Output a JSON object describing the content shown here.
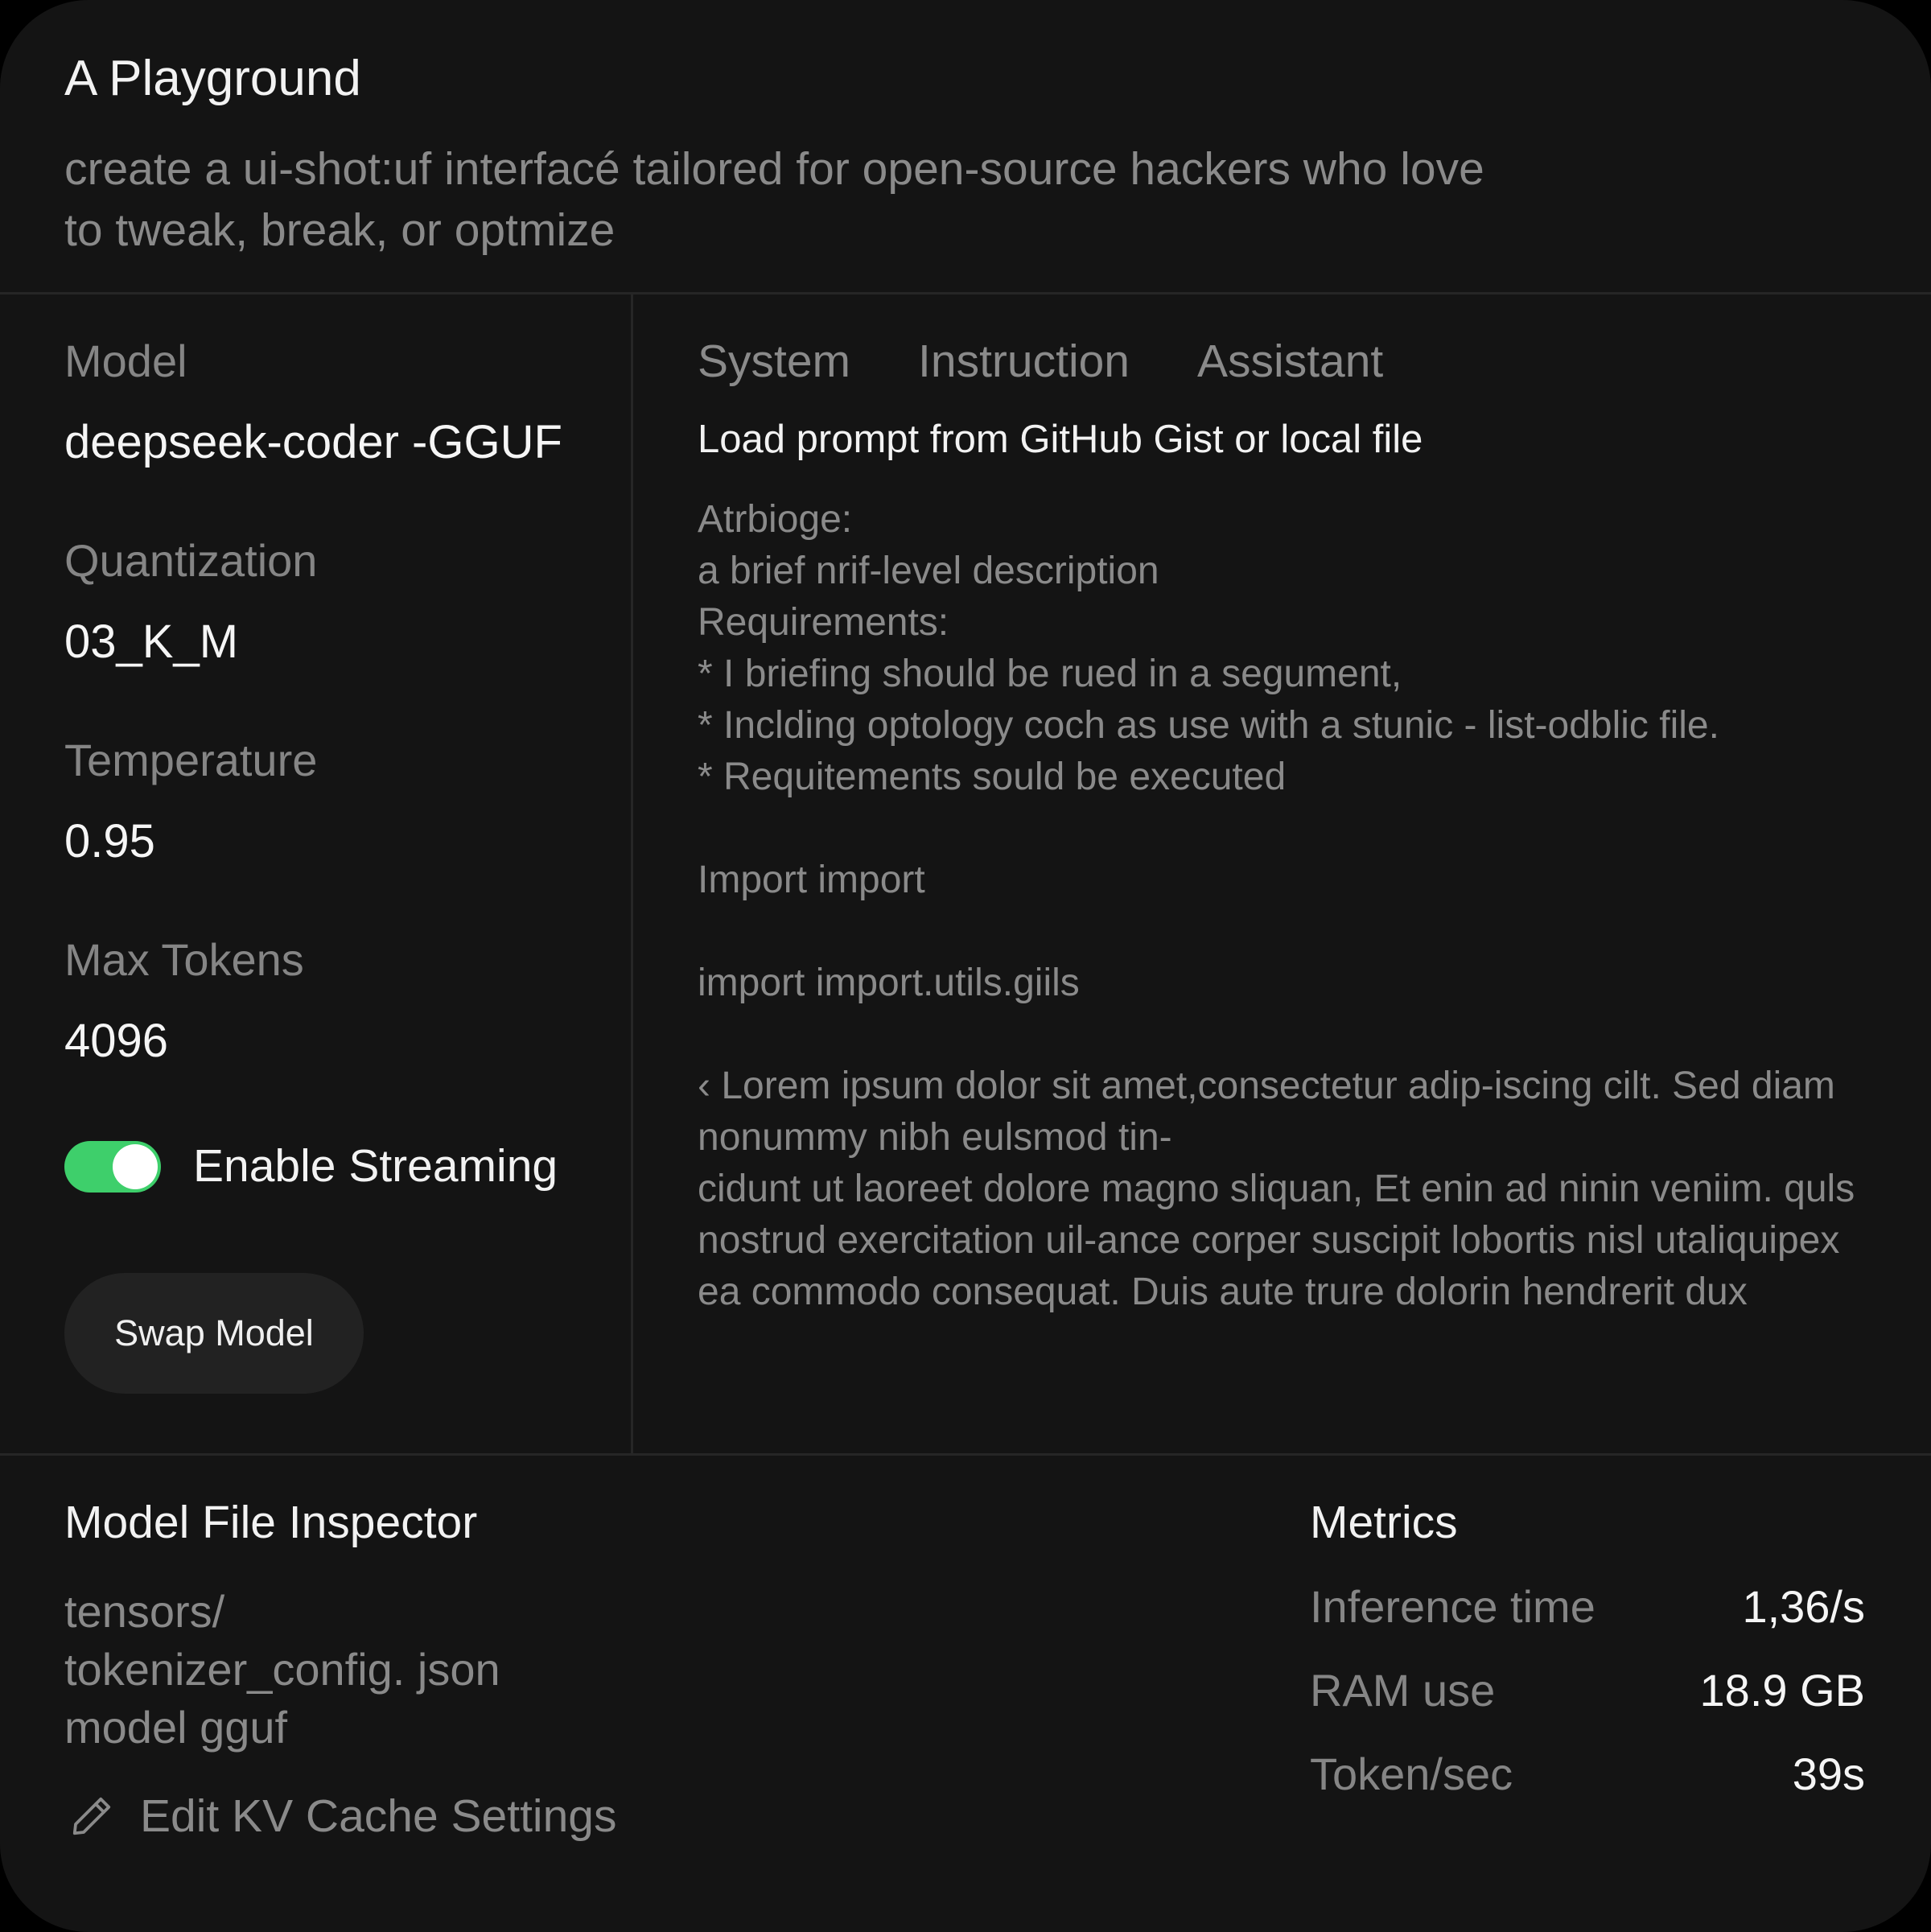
{
  "header": {
    "title": "A Playground",
    "subtitle_line1": "create a ui-shot:uf interfacé tailored for open-source hackers who love",
    "subtitle_line2": "to tweak, break, or optmize"
  },
  "settings": {
    "model": {
      "label": "Model",
      "value": "deepseek-coder -GGUF"
    },
    "quantization": {
      "label": "Quantization",
      "value": "03_K_M"
    },
    "temperature": {
      "label": "Temperature",
      "value": "0.95"
    },
    "max_tokens": {
      "label": "Max Tokens",
      "value": "4096"
    },
    "streaming": {
      "label": "Enable Streaming",
      "enabled": true
    },
    "swap_button_label": "Swap Model"
  },
  "editor": {
    "tabs": [
      {
        "label": "System"
      },
      {
        "label": "Instruction"
      },
      {
        "label": "Assistant"
      }
    ],
    "load_prompt_label": "Load prompt from GitHub Gist or local file",
    "prompt_lines": [
      "Atrbioge:",
      "a brief nrif-level description",
      "Requirements:",
      "* I briefing should be rued in a segument,",
      "* Inclding optology coch as use with a stunic - list-odblic file.",
      "* Requitements sould be executed"
    ],
    "import_line_1": "Import import",
    "import_line_2": "import import.utils.giils",
    "lorem_lines": [
      "‹ Lorem ipsum dolor sit amet,consectetur adip-iscing cilt. Sed diam",
      "nonummy nibh eulsmod tin-",
      "cidunt ut laoreet dolore magno sliquan, Et enin ad ninin veniim. quls",
      "nostrud exercitation uil-ance corper suscipit lobortis nisl utaliquipex",
      "ea commodo consequat. Duis aute trure dolorin hendrerit dux"
    ]
  },
  "inspector": {
    "title": "Model File Inspector",
    "files": [
      "tensors/",
      "tokenizer_config. json",
      "model gguf"
    ],
    "edit_kv_label": "Edit KV Cache Settings",
    "edit_icon": "pencil-icon"
  },
  "metrics": {
    "title": "Metrics",
    "rows": [
      {
        "label": "Inference time",
        "value": "1,36/s"
      },
      {
        "label": "RAM use",
        "value": "18.9 GB"
      },
      {
        "label": "Token/sec",
        "value": "39s"
      }
    ]
  },
  "colors": {
    "background": "#141414",
    "toggle_on": "#3ecf6b",
    "divider": "#262626",
    "muted_text": "#8a8a8a",
    "primary_text": "#f2f2f2"
  }
}
